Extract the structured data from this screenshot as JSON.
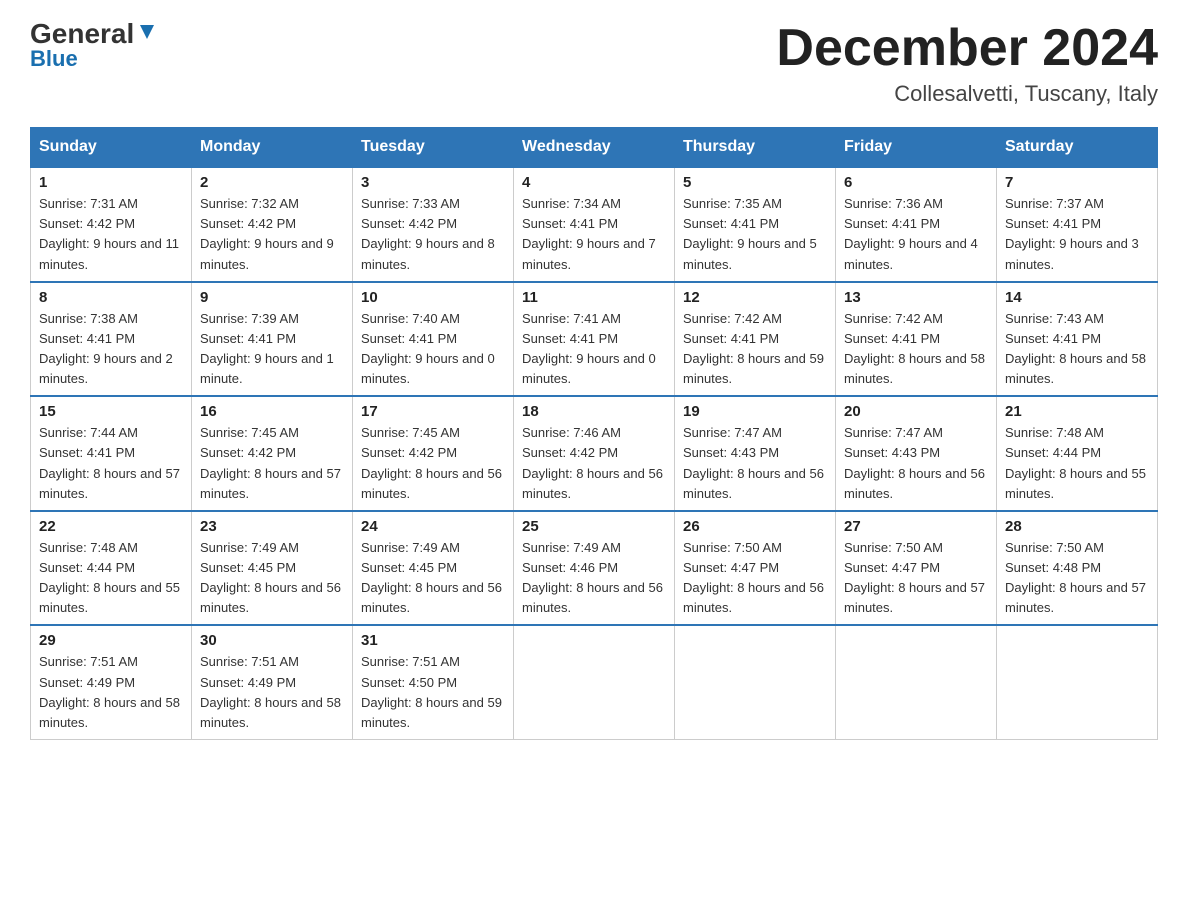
{
  "logo": {
    "general": "General",
    "blue": "Blue"
  },
  "title": "December 2024",
  "subtitle": "Collesalvetti, Tuscany, Italy",
  "weekdays": [
    "Sunday",
    "Monday",
    "Tuesday",
    "Wednesday",
    "Thursday",
    "Friday",
    "Saturday"
  ],
  "weeks": [
    [
      {
        "day": "1",
        "sunrise": "7:31 AM",
        "sunset": "4:42 PM",
        "daylight": "9 hours and 11 minutes."
      },
      {
        "day": "2",
        "sunrise": "7:32 AM",
        "sunset": "4:42 PM",
        "daylight": "9 hours and 9 minutes."
      },
      {
        "day": "3",
        "sunrise": "7:33 AM",
        "sunset": "4:42 PM",
        "daylight": "9 hours and 8 minutes."
      },
      {
        "day": "4",
        "sunrise": "7:34 AM",
        "sunset": "4:41 PM",
        "daylight": "9 hours and 7 minutes."
      },
      {
        "day": "5",
        "sunrise": "7:35 AM",
        "sunset": "4:41 PM",
        "daylight": "9 hours and 5 minutes."
      },
      {
        "day": "6",
        "sunrise": "7:36 AM",
        "sunset": "4:41 PM",
        "daylight": "9 hours and 4 minutes."
      },
      {
        "day": "7",
        "sunrise": "7:37 AM",
        "sunset": "4:41 PM",
        "daylight": "9 hours and 3 minutes."
      }
    ],
    [
      {
        "day": "8",
        "sunrise": "7:38 AM",
        "sunset": "4:41 PM",
        "daylight": "9 hours and 2 minutes."
      },
      {
        "day": "9",
        "sunrise": "7:39 AM",
        "sunset": "4:41 PM",
        "daylight": "9 hours and 1 minute."
      },
      {
        "day": "10",
        "sunrise": "7:40 AM",
        "sunset": "4:41 PM",
        "daylight": "9 hours and 0 minutes."
      },
      {
        "day": "11",
        "sunrise": "7:41 AM",
        "sunset": "4:41 PM",
        "daylight": "9 hours and 0 minutes."
      },
      {
        "day": "12",
        "sunrise": "7:42 AM",
        "sunset": "4:41 PM",
        "daylight": "8 hours and 59 minutes."
      },
      {
        "day": "13",
        "sunrise": "7:42 AM",
        "sunset": "4:41 PM",
        "daylight": "8 hours and 58 minutes."
      },
      {
        "day": "14",
        "sunrise": "7:43 AM",
        "sunset": "4:41 PM",
        "daylight": "8 hours and 58 minutes."
      }
    ],
    [
      {
        "day": "15",
        "sunrise": "7:44 AM",
        "sunset": "4:41 PM",
        "daylight": "8 hours and 57 minutes."
      },
      {
        "day": "16",
        "sunrise": "7:45 AM",
        "sunset": "4:42 PM",
        "daylight": "8 hours and 57 minutes."
      },
      {
        "day": "17",
        "sunrise": "7:45 AM",
        "sunset": "4:42 PM",
        "daylight": "8 hours and 56 minutes."
      },
      {
        "day": "18",
        "sunrise": "7:46 AM",
        "sunset": "4:42 PM",
        "daylight": "8 hours and 56 minutes."
      },
      {
        "day": "19",
        "sunrise": "7:47 AM",
        "sunset": "4:43 PM",
        "daylight": "8 hours and 56 minutes."
      },
      {
        "day": "20",
        "sunrise": "7:47 AM",
        "sunset": "4:43 PM",
        "daylight": "8 hours and 56 minutes."
      },
      {
        "day": "21",
        "sunrise": "7:48 AM",
        "sunset": "4:44 PM",
        "daylight": "8 hours and 55 minutes."
      }
    ],
    [
      {
        "day": "22",
        "sunrise": "7:48 AM",
        "sunset": "4:44 PM",
        "daylight": "8 hours and 55 minutes."
      },
      {
        "day": "23",
        "sunrise": "7:49 AM",
        "sunset": "4:45 PM",
        "daylight": "8 hours and 56 minutes."
      },
      {
        "day": "24",
        "sunrise": "7:49 AM",
        "sunset": "4:45 PM",
        "daylight": "8 hours and 56 minutes."
      },
      {
        "day": "25",
        "sunrise": "7:49 AM",
        "sunset": "4:46 PM",
        "daylight": "8 hours and 56 minutes."
      },
      {
        "day": "26",
        "sunrise": "7:50 AM",
        "sunset": "4:47 PM",
        "daylight": "8 hours and 56 minutes."
      },
      {
        "day": "27",
        "sunrise": "7:50 AM",
        "sunset": "4:47 PM",
        "daylight": "8 hours and 57 minutes."
      },
      {
        "day": "28",
        "sunrise": "7:50 AM",
        "sunset": "4:48 PM",
        "daylight": "8 hours and 57 minutes."
      }
    ],
    [
      {
        "day": "29",
        "sunrise": "7:51 AM",
        "sunset": "4:49 PM",
        "daylight": "8 hours and 58 minutes."
      },
      {
        "day": "30",
        "sunrise": "7:51 AM",
        "sunset": "4:49 PM",
        "daylight": "8 hours and 58 minutes."
      },
      {
        "day": "31",
        "sunrise": "7:51 AM",
        "sunset": "4:50 PM",
        "daylight": "8 hours and 59 minutes."
      },
      null,
      null,
      null,
      null
    ]
  ]
}
